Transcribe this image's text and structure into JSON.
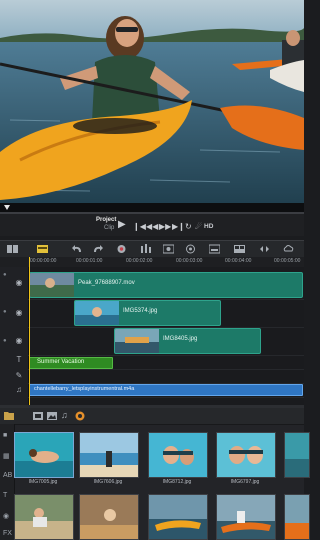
{
  "transport": {
    "mode_project": "Project",
    "mode_clip": "Clip",
    "hd_label": "HD",
    "buttons": [
      "play-icon",
      "rewind-icon",
      "step-back-icon",
      "step-forward-icon",
      "fast-forward-icon",
      "repeat-icon",
      "volume-icon",
      "hd-icon"
    ]
  },
  "ruler": {
    "ticks": [
      "00:00:00:00",
      "00:00:01:00",
      "00:00:02:00",
      "00:00:03:00",
      "00:00:04:00",
      "00:00:05:00"
    ]
  },
  "timeline": {
    "clips": [
      {
        "label": "Peak_97688907.mov"
      },
      {
        "label": "IMG5374.jpg"
      },
      {
        "label": "IMG8405.jpg"
      }
    ],
    "title_clip": "Summer Vacation",
    "audio_clip": "chantellebarry_letsplayinstrumentral.m4a"
  },
  "library": {
    "items": [
      {
        "label": "IMG7005.jpg"
      },
      {
        "label": "IMG7606.jpg"
      },
      {
        "label": "IMG8712.jpg"
      },
      {
        "label": "IMG6797.jpg"
      },
      {
        "label": ""
      },
      {
        "label": ""
      },
      {
        "label": ""
      },
      {
        "label": ""
      }
    ]
  },
  "colors": {
    "video_clip": "#1d7a68",
    "title_clip": "#2f8b22",
    "audio_clip": "#2f76c3",
    "playhead": "#f0c419"
  }
}
